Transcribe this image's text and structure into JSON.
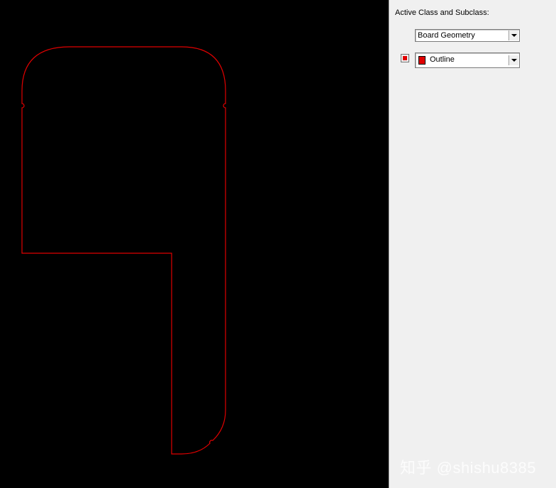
{
  "panel": {
    "title": "Active Class and Subclass:",
    "class_dropdown": {
      "value": "Board Geometry"
    },
    "subclass_dropdown": {
      "value": "Outline"
    }
  },
  "canvas": {
    "outline_color": "#e00000",
    "background_color": "#000000"
  },
  "watermark": "知乎 @shishu8385",
  "icons": {
    "dropdown_arrow": "chevron-down-icon",
    "color_button": "color-swatch-icon"
  }
}
